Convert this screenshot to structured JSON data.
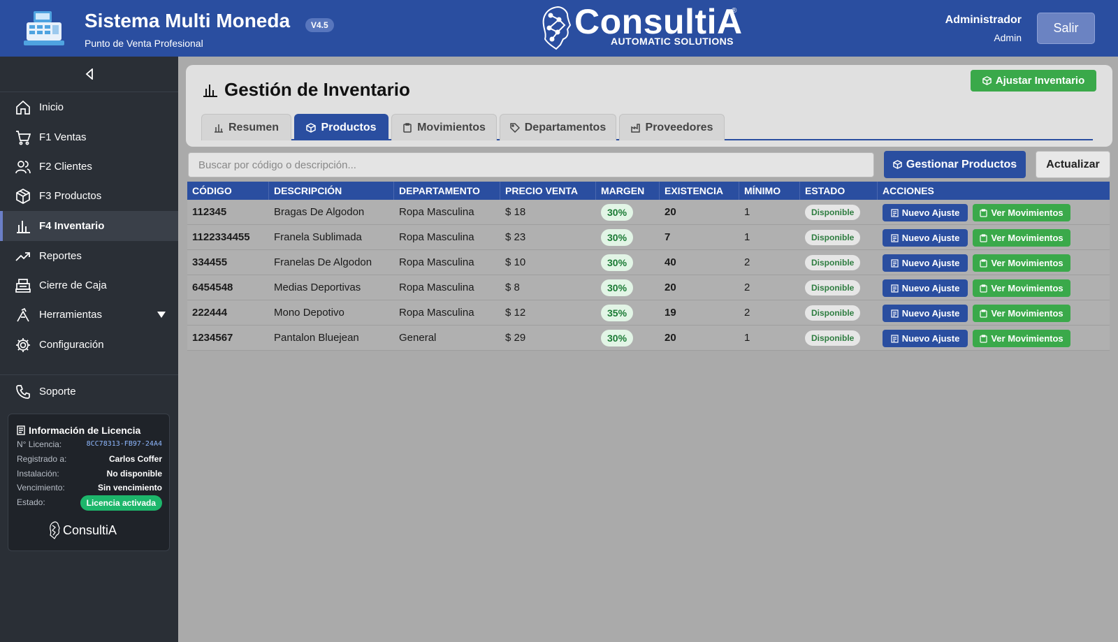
{
  "header": {
    "app_title": "Sistema Multi Moneda",
    "version": "V4.5",
    "subtitle": "Punto de Venta Profesional",
    "brand_name": "ConsultiA",
    "brand_reg": "®",
    "brand_tagline": "AUTOMATIC SOLUTIONS",
    "user_name": "Administrador",
    "user_role": "Admin",
    "logout_label": "Salir"
  },
  "sidebar": {
    "items": [
      {
        "label": "Inicio",
        "icon": "home-icon"
      },
      {
        "label": "F1 Ventas",
        "icon": "cart-icon"
      },
      {
        "label": "F2 Clientes",
        "icon": "users-icon"
      },
      {
        "label": "F3 Productos",
        "icon": "box-icon"
      },
      {
        "label": "F4 Inventario",
        "icon": "bar-chart-icon",
        "active": true
      },
      {
        "label": "Reportes",
        "icon": "trend-icon"
      },
      {
        "label": "Cierre de Caja",
        "icon": "register-icon"
      },
      {
        "label": "Herramientas",
        "icon": "tools-icon"
      },
      {
        "label": "Configuración",
        "icon": "gear-icon"
      }
    ],
    "support_label": "Soporte",
    "license": {
      "title": "Información de Licencia",
      "rows": [
        {
          "k": "N° Licencia:",
          "v": "8CC78313-FB97-24A4"
        },
        {
          "k": "Registrado a:",
          "v": "Carlos Coffer"
        },
        {
          "k": "Instalación:",
          "v": "No disponible"
        },
        {
          "k": "Vencimiento:",
          "v": "Sin vencimiento"
        },
        {
          "k": "Estado:",
          "v": "Licencia activada"
        }
      ],
      "logo_text": "ConsultiA",
      "logo_reg": "®"
    }
  },
  "main": {
    "title": "Gestión de Inventario",
    "adjust_button": "Ajustar Inventario",
    "tabs": [
      {
        "label": "Resumen"
      },
      {
        "label": "Productos",
        "active": true
      },
      {
        "label": "Movimientos"
      },
      {
        "label": "Departamentos"
      },
      {
        "label": "Proveedores"
      }
    ],
    "search_placeholder": "Buscar por código o descripción...",
    "manage_button": "Gestionar Productos",
    "refresh_button": "Actualizar"
  },
  "table": {
    "columns": [
      "CÓDIGO",
      "DESCRIPCIÓN",
      "DEPARTAMENTO",
      "PRECIO VENTA",
      "MARGEN",
      "EXISTENCIA",
      "MÍNIMO",
      "ESTADO",
      "ACCIONES"
    ],
    "action_new": "Nuevo Ajuste",
    "action_moves": "Ver Movimientos",
    "rows": [
      {
        "code": "112345",
        "desc": "Bragas De Algodon",
        "dept": "Ropa Masculina",
        "price": "$ 18",
        "margin": "30%",
        "stock": "20",
        "min": "1",
        "status": "Disponible"
      },
      {
        "code": "1122334455",
        "desc": "Franela Sublimada",
        "dept": "Ropa Masculina",
        "price": "$ 23",
        "margin": "30%",
        "stock": "7",
        "min": "1",
        "status": "Disponible"
      },
      {
        "code": "334455",
        "desc": "Franelas De Algodon",
        "dept": "Ropa Masculina",
        "price": "$ 10",
        "margin": "30%",
        "stock": "40",
        "min": "2",
        "status": "Disponible"
      },
      {
        "code": "6454548",
        "desc": "Medias Deportivas",
        "dept": "Ropa Masculina",
        "price": "$ 8",
        "margin": "30%",
        "stock": "20",
        "min": "2",
        "status": "Disponible"
      },
      {
        "code": "222444",
        "desc": "Mono Depotivo",
        "dept": "Ropa Masculina",
        "price": "$ 12",
        "margin": "35%",
        "stock": "19",
        "min": "2",
        "status": "Disponible"
      },
      {
        "code": "1234567",
        "desc": "Pantalon Bluejean",
        "dept": "General",
        "price": "$ 29",
        "margin": "30%",
        "stock": "20",
        "min": "1",
        "status": "Disponible"
      }
    ]
  }
}
